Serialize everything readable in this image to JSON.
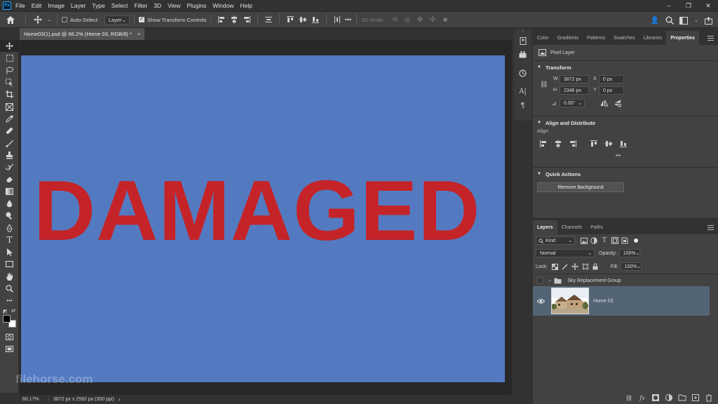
{
  "menu": {
    "app_icon": "Ps",
    "items": [
      "File",
      "Edit",
      "Image",
      "Layer",
      "Type",
      "Select",
      "Filter",
      "3D",
      "View",
      "Plugins",
      "Window",
      "Help"
    ],
    "window_controls": [
      "–",
      "❐",
      "✕"
    ]
  },
  "options_bar": {
    "auto_select_label": "Auto-Select:",
    "auto_select_target": "Layer",
    "show_transform_label": "Show Transform Controls",
    "three_d_mode_label": "3D Mode:"
  },
  "document": {
    "tab_title": "Home03(1).psd @ 66.2% (Home 03, RGB/8) *",
    "tab_close": "×",
    "canvas_text": "DAMAGED",
    "canvas_color": "#537ac1",
    "text_color": "#c42428",
    "watermark": "filehorse.com"
  },
  "status": {
    "zoom": "66.17%",
    "info": "3872 px x 2592 px (300 ppi)"
  },
  "properties_panel": {
    "tabs": [
      "Color",
      "Gradients",
      "Patterns",
      "Swatches",
      "Libraries",
      "Properties"
    ],
    "active_tab": "Properties",
    "layer_type": "Pixel Layer",
    "transform": {
      "title": "Transform",
      "w_label": "W",
      "w_value": "3872 px",
      "h_label": "H",
      "h_value": "2346 px",
      "x_label": "X",
      "x_value": "0 px",
      "y_label": "Y",
      "y_value": "0 px",
      "angle_value": "0.00°"
    },
    "align": {
      "title": "Align and Distribute",
      "align_label": "Align:",
      "more": "•••"
    },
    "quick_actions": {
      "title": "Quick Actions",
      "remove_bg": "Remove Background"
    }
  },
  "layers_panel": {
    "tabs": [
      "Layers",
      "Channels",
      "Paths"
    ],
    "active_tab": "Layers",
    "filter_kind": "Kind",
    "blend_mode": "Normal",
    "opacity_label": "Opacity:",
    "opacity_value": "100%",
    "lock_label": "Lock:",
    "fill_label": "Fill:",
    "fill_value": "100%",
    "layers": [
      {
        "name": "Sky Replacement Group",
        "type": "group",
        "visible": false
      },
      {
        "name": "Home 03",
        "type": "pixel",
        "visible": true,
        "selected": true
      }
    ]
  }
}
